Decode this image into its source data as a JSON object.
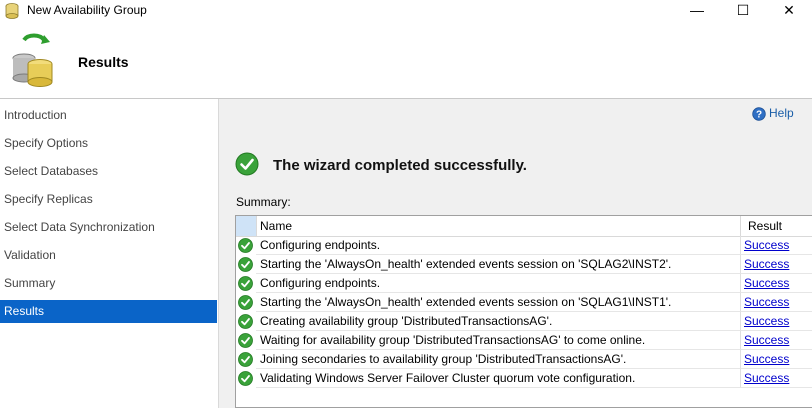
{
  "window": {
    "title": "New Availability Group",
    "minimize_glyph": "—",
    "maximize_glyph": "☐",
    "close_glyph": "✕"
  },
  "header": {
    "title": "Results",
    "icon": "database-sync-icon"
  },
  "sidebar": {
    "items": [
      {
        "label": "Introduction",
        "active": false
      },
      {
        "label": "Specify Options",
        "active": false
      },
      {
        "label": "Select Databases",
        "active": false
      },
      {
        "label": "Specify Replicas",
        "active": false
      },
      {
        "label": "Select Data Synchronization",
        "active": false
      },
      {
        "label": "Validation",
        "active": false
      },
      {
        "label": "Summary",
        "active": false
      },
      {
        "label": "Results",
        "active": true
      }
    ]
  },
  "main": {
    "help_label": "Help",
    "success_message": "The wizard completed successfully.",
    "summary_label": "Summary:",
    "columns": {
      "name": "Name",
      "result": "Result"
    },
    "rows": [
      {
        "name": "Configuring endpoints.",
        "result": "Success"
      },
      {
        "name": "Starting the 'AlwaysOn_health' extended events session on 'SQLAG2\\INST2'.",
        "result": "Success"
      },
      {
        "name": "Configuring endpoints.",
        "result": "Success"
      },
      {
        "name": "Starting the 'AlwaysOn_health' extended events session on 'SQLAG1\\INST1'.",
        "result": "Success"
      },
      {
        "name": "Creating availability group 'DistributedTransactionsAG'.",
        "result": "Success"
      },
      {
        "name": "Waiting for availability group 'DistributedTransactionsAG' to come online.",
        "result": "Success"
      },
      {
        "name": "Joining secondaries to availability group 'DistributedTransactionsAG'.",
        "result": "Success"
      },
      {
        "name": "Validating Windows Server Failover Cluster quorum vote configuration.",
        "result": "Success"
      }
    ]
  },
  "colors": {
    "accent": "#0a64c8",
    "success_green": "#3aa23a",
    "link": "#0000cc"
  }
}
